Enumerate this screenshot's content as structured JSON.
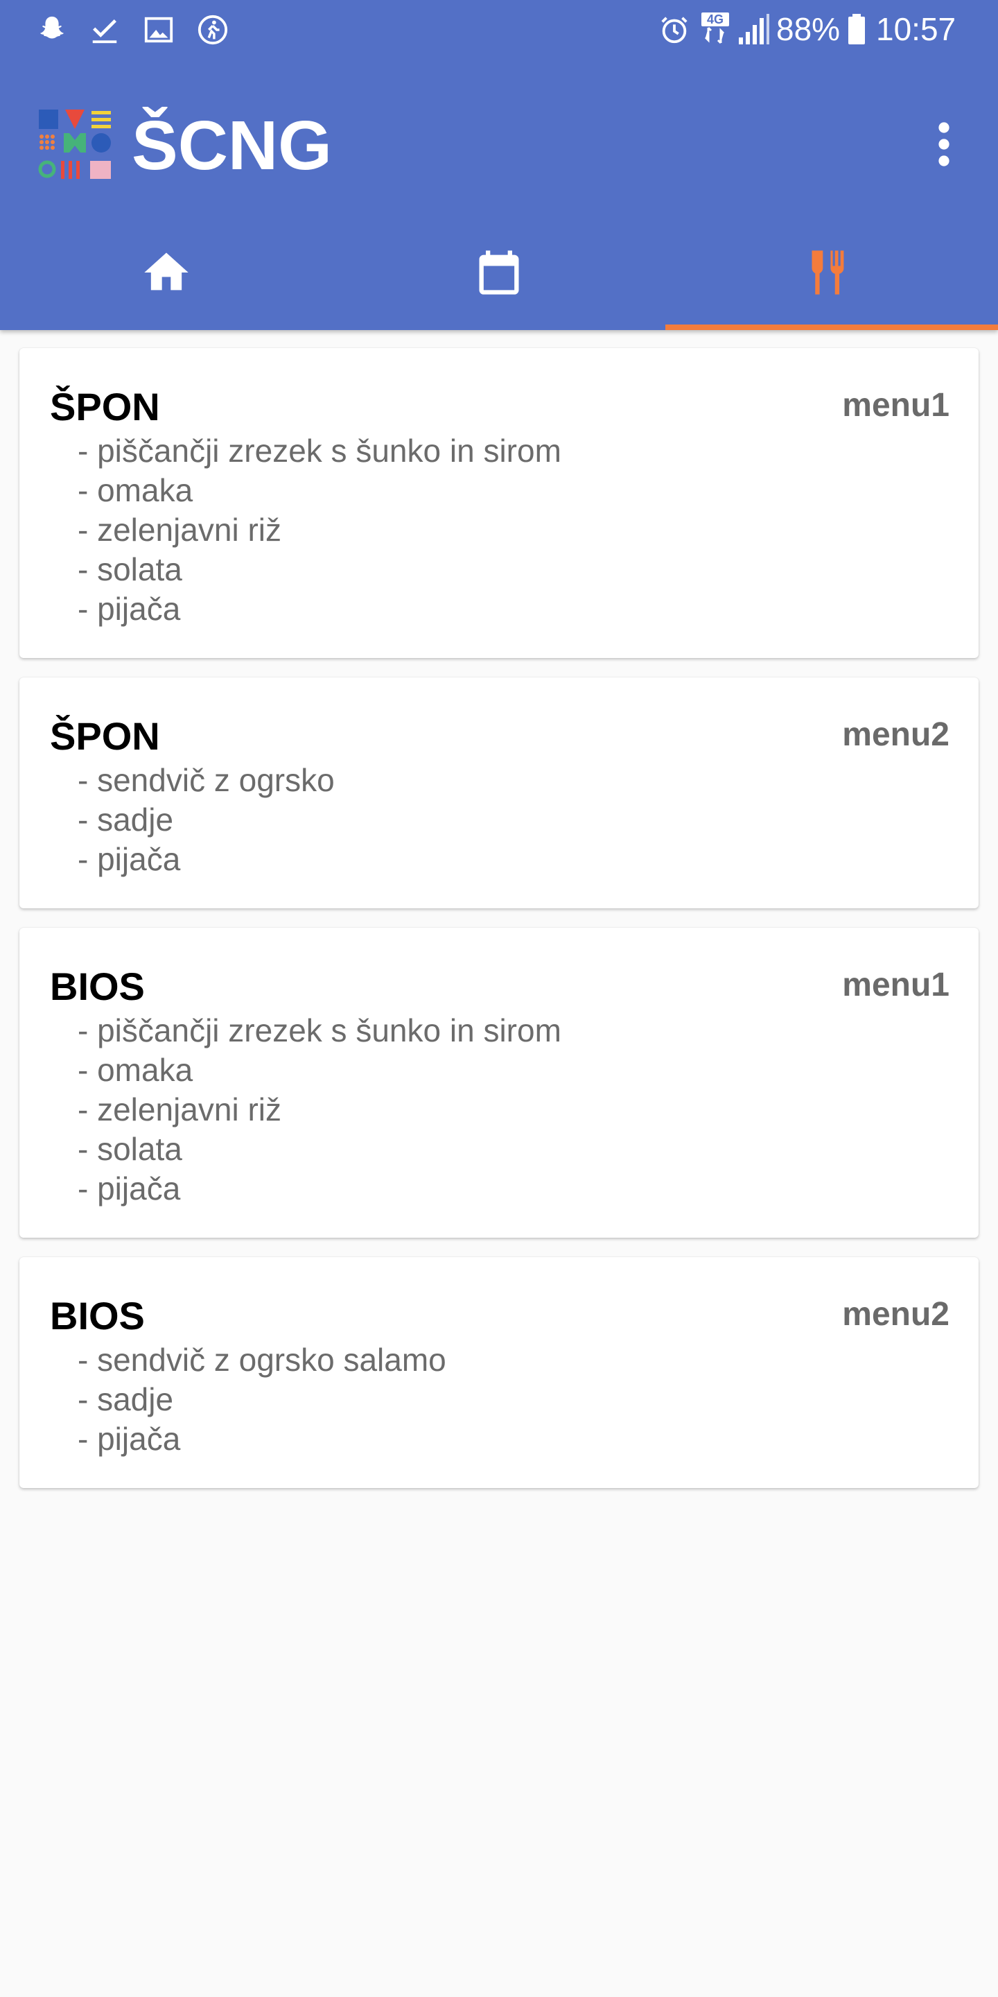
{
  "status_bar": {
    "battery_percent": "88%",
    "time": "10:57",
    "network_label": "4G",
    "icons": [
      "snapchat-icon",
      "check-icon",
      "image-icon",
      "activity-icon",
      "alarm-icon",
      "network-4g-icon",
      "signal-icon",
      "battery-icon"
    ]
  },
  "app": {
    "title": "ŠCNG",
    "menu_icon": "more-vert-icon"
  },
  "tabs": [
    {
      "name": "home",
      "icon": "home-icon",
      "active": false
    },
    {
      "name": "calendar",
      "icon": "calendar-icon",
      "active": false
    },
    {
      "name": "restaurant",
      "icon": "restaurant-icon",
      "active": true
    }
  ],
  "colors": {
    "appbar": "#5370c6",
    "accent": "#f47c3c",
    "background": "#fafafa",
    "card": "#ffffff"
  },
  "cards": [
    {
      "title": "ŠPON",
      "menu": "menu1",
      "items": [
        "- piščančji zrezek s šunko in sirom",
        "- omaka",
        "- zelenjavni riž",
        "- solata",
        "- pijača"
      ]
    },
    {
      "title": "ŠPON",
      "menu": "menu2",
      "items": [
        "- sendvič z ogrsko",
        "- sadje",
        "- pijača"
      ]
    },
    {
      "title": "BIOS",
      "menu": "menu1",
      "items": [
        "- piščančji zrezek s šunko in sirom",
        "- omaka",
        "- zelenjavni riž",
        "- solata",
        "- pijača"
      ]
    },
    {
      "title": "BIOS",
      "menu": "menu2",
      "items": [
        "- sendvič z ogrsko salamo",
        "- sadje",
        "- pijača"
      ]
    }
  ]
}
